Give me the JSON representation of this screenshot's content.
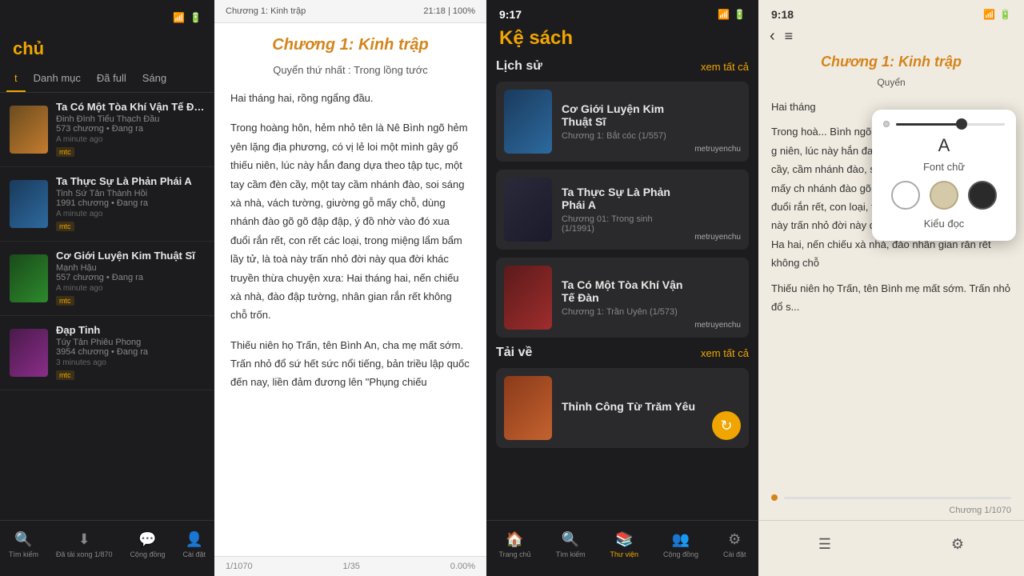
{
  "library": {
    "title": "chủ",
    "tabs": [
      {
        "label": "t",
        "active": true
      },
      {
        "label": "Danh mục",
        "active": false
      },
      {
        "label": "Đã full",
        "active": false
      },
      {
        "label": "Sáng",
        "active": false
      }
    ],
    "books": [
      {
        "id": 1,
        "title": "Ta Có Một Tòa Khí Vận Tế Đàn",
        "author": "Đinh Đình Tiểu Thạch Đầu",
        "chapters": "573 chương • Đang ra",
        "time": "A minute ago",
        "badge": "mtc",
        "coverClass": "cover1"
      },
      {
        "id": 2,
        "title": "Ta Thực Sự Là Phản Phái A",
        "author": "Tinh Sứ Tản Thành Hồi",
        "chapters": "1991 chương • Đang ra",
        "time": "A minute ago",
        "badge": "mtc",
        "coverClass": "cover2"
      },
      {
        "id": 3,
        "title": "Cơ Giới Luyện Kim Thuật Sĩ",
        "author": "Mạnh Hậu",
        "chapters": "557 chương • Đang ra",
        "time": "A minute ago",
        "badge": "mtc",
        "coverClass": "cover3"
      },
      {
        "id": 4,
        "title": "Đạp Tinh",
        "author": "Túy Tản Phiêu Phong",
        "chapters": "3954 chương • Đang ra",
        "time": "3 minutes ago",
        "badge": "mtc",
        "coverClass": "cover4"
      }
    ],
    "bottomNav": [
      {
        "label": "Tìm kiếm",
        "icon": "🔍",
        "active": false
      },
      {
        "label": "Đã tải xong 1/870",
        "icon": "⬇",
        "active": false
      },
      {
        "label": "Cộng đồng",
        "icon": "💬",
        "active": false
      },
      {
        "label": "Cài đặt",
        "icon": "👤",
        "active": false
      }
    ]
  },
  "reader": {
    "topBar": {
      "chapterName": "Chương 1: Kinh trập",
      "time": "21:18",
      "zoom": "100%"
    },
    "chapterTitle": "Chương 1: Kinh trập",
    "subtitle": "Quyển thứ nhất : Trong lồng tước",
    "paragraphs": [
      "Hai tháng hai, rồng ngẩng đầu.",
      "Trong hoàng hôn, hẻm nhỏ tên là Nê Bình ngõ hẻm yên lặng địa phương, có vị lẻ loi một mình gây gổ thiếu niên, lúc này hắn đang dựa theo tập tục, một tay cầm đèn cầy, một tay cầm nhánh đào, soi sáng xà nhà, vách tường, giường gỗ mấy chỗ, dùng nhánh đào gõ gõ đập đập, ý đồ nhờ vào đó xua đuổi rắn rết, con rết các loại, trong miệng lẩm bẩm lầy tử, là toà này trấn nhỏ đời này qua đời khác truyền thừa chuyện xưa: Hai tháng hai, nến chiếu xà nhà, đào đập tường, nhân gian rắn rết không chỗ trốn.",
      "Thiếu niên họ Trấn, tên Bình An, cha mẹ mất sớm. Trấn nhỏ đổ sứ hết sức nổi tiếng, bản triều lập quốc đến nay, liền đảm đương lên \"Phụng chiếu"
    ],
    "bottomBar": {
      "pageInfo": "1/1070",
      "position": "1/35",
      "percent": "0.00%"
    }
  },
  "shelf": {
    "statusTime": "9:17",
    "title": "Kệ sách",
    "sections": [
      {
        "title": "Lịch sử",
        "seeAll": "xem tất cả",
        "books": [
          {
            "title": "Cơ Giới Luyện Kim Thuật Sĩ",
            "chapter": "Chương 1: Bắt cóc (1/557)",
            "thumbClass": "t1",
            "author": "metruyenchu"
          },
          {
            "title": "Ta Thực Sự Là Phản Phái A",
            "chapter": "Chương 01: Trong sinh (1/1991)",
            "thumbClass": "t2",
            "author": "metruyenchu"
          },
          {
            "title": "Ta Có Một Tòa Khí Vận Tế Đàn",
            "chapter": "Chương 1: Trần Uyên (1/573)",
            "thumbClass": "t3",
            "author": "metruyenchu"
          }
        ]
      },
      {
        "title": "Tải về",
        "seeAll": "xem tất cả",
        "books": [
          {
            "title": "Thỉnh Công Từ Trăm Yêu",
            "chapter": "",
            "thumbClass": "t1",
            "author": ""
          }
        ]
      }
    ],
    "bottomNav": [
      {
        "label": "Trang chủ",
        "icon": "🏠",
        "active": false
      },
      {
        "label": "Tìm kiếm",
        "icon": "🔍",
        "active": false
      },
      {
        "label": "Thư viện",
        "icon": "📚",
        "active": true
      },
      {
        "label": "Cộng đồng",
        "icon": "👥",
        "active": false
      },
      {
        "label": "Cài đặt",
        "icon": "⚙",
        "active": false
      }
    ]
  },
  "readerSettings": {
    "statusTime": "9:18",
    "chapterTitle": "Chương 1: Kinh trập",
    "subtitle": "Quyển",
    "paragraphs": [
      "Hai tháng",
      "Trong hoà... Bình ngõ h... có vị lẻ loi một mình gay g niên, lúc này hắn đang dựa tục, một tay cầm đèn cầy, cầm nhánh đào, soi sáng xà tường, giường gỗ mấy ch nhánh đào gõ gõ đập đập, ý vào đó xua đuổi rắn rết, con loại, trong miệng lẩm bẩm lẩ toà này trấn nhỏ đời này qua truyền thừa chuyện xưa: Ha hai, nến chiếu xà nhà, đào nhân gian rắn rết không chỗ",
      "Thiếu niên họ Trấn, tên Bình mẹ mất sớm. Trấn nhỏ đổ s..."
    ],
    "fontPopup": {
      "label": "Font chữ",
      "kieudoc": "Kiểu đọc",
      "themes": [
        "white",
        "beige",
        "dark"
      ]
    },
    "progressLabel": "Chương 1/1070",
    "bottomNav": [
      {
        "icon": "☰",
        "active": false
      },
      {
        "icon": "⚙",
        "active": false
      }
    ]
  }
}
